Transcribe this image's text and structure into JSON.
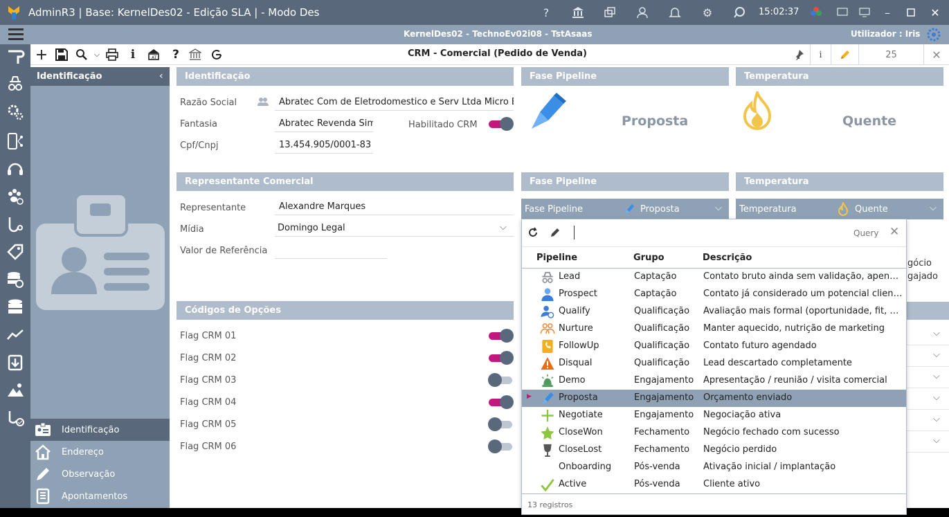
{
  "window": {
    "title": "AdminR3 | Base: KernelDes02 - Edição SLA | - Modo Des",
    "clock": "15:02:37"
  },
  "statusbar": {
    "center": "KernelDes02 - TechnoEv02i08 - TstAsaas",
    "user": "Utilizador : Iris"
  },
  "toolbar": {
    "form_title": "CRM - Comercial (Pedido de Venda)",
    "info": "i",
    "record": "25"
  },
  "sidebar": {
    "header": "Identificação",
    "nav": [
      {
        "label": "Identificação",
        "icon": "id-card-icon"
      },
      {
        "label": "Endereço",
        "icon": "house-icon"
      },
      {
        "label": "Observação",
        "icon": "pencil-icon"
      },
      {
        "label": "Apontamentos",
        "icon": "notebook-icon"
      }
    ]
  },
  "identificacao": {
    "header": "Identificação",
    "razao_label": "Razão Social",
    "razao_value": "Abratec Com de Eletrodomestico e Serv Ltda Micro Em",
    "fantasia_label": "Fantasia",
    "fantasia_value": "Abratec Revenda Sim",
    "habilitado_label": "Habilitado CRM",
    "habilitado_on": true,
    "cpf_label": "Cpf/Cnpj",
    "cpf_value": "13.454.905/0001-83"
  },
  "fase_top": {
    "header": "Fase Pipeline",
    "value": "Proposta"
  },
  "temp_top": {
    "header": "Temperatura",
    "value": "Quente"
  },
  "representante": {
    "header": "Representante Comercial",
    "rep_label": "Representante",
    "rep_value": "Alexandre Marques",
    "midia_label": "Mídia",
    "midia_value": "Domingo Legal",
    "valor_label": "Valor de Referência",
    "valor_value": ""
  },
  "fase_mid": {
    "header": "Fase Pipeline",
    "label": "Fase Pipeline",
    "value": "Proposta"
  },
  "temp_mid": {
    "header": "Temperatura",
    "label": "Temperatura",
    "value": "Quente"
  },
  "codigos": {
    "header": "Códigos de Opções",
    "flags": [
      {
        "label": "Flag CRM 01",
        "on": true
      },
      {
        "label": "Flag CRM 02",
        "on": true
      },
      {
        "label": "Flag CRM 03",
        "on": false
      },
      {
        "label": "Flag CRM 04",
        "on": true
      },
      {
        "label": "Flag CRM 05",
        "on": false
      },
      {
        "label": "Flag CRM 06",
        "on": false
      }
    ]
  },
  "behind_text": {
    "line1": "gócio",
    "line2": "gajado"
  },
  "dropdown": {
    "search_value": "",
    "query_label": "Query",
    "columns": [
      "Pipeline",
      "Grupo",
      "Descrição"
    ],
    "rows": [
      {
        "pipeline": "Lead",
        "grupo": "Captação",
        "descricao": "Contato bruto ainda sem validação, apenas...",
        "icon": "spy-icon"
      },
      {
        "pipeline": "Prospect",
        "grupo": "Captação",
        "descricao": "Contato já considerado um potencial cliente...",
        "icon": "person-icon"
      },
      {
        "pipeline": "Qualify",
        "grupo": "Qualificação",
        "descricao": "Avaliação mais formal (oportunidade, fit, nec...",
        "icon": "person-filter-icon"
      },
      {
        "pipeline": "Nurture",
        "grupo": "Qualificação",
        "descricao": "Manter aquecido, nutrição de marketing",
        "icon": "people-icon"
      },
      {
        "pipeline": "FollowUp",
        "grupo": "Qualificação",
        "descricao": "Contato futuro agendado",
        "icon": "phone-book-icon"
      },
      {
        "pipeline": "Disqual",
        "grupo": "Qualificação",
        "descricao": "Lead descartado completamente",
        "icon": "warning-icon"
      },
      {
        "pipeline": "Demo",
        "grupo": "Engajamento",
        "descricao": "Apresentação / reunião / visita comercial",
        "icon": "siren-icon"
      },
      {
        "pipeline": "Proposta",
        "grupo": "Engajamento",
        "descricao": "Orçamento enviado",
        "icon": "pen-icon"
      },
      {
        "pipeline": "Negotiate",
        "grupo": "Engajamento",
        "descricao": "Negociação ativa",
        "icon": "plus-icon"
      },
      {
        "pipeline": "CloseWon",
        "grupo": "Fechamento",
        "descricao": "Negócio fechado com sucesso",
        "icon": "star-icon"
      },
      {
        "pipeline": "CloseLost",
        "grupo": "Fechamento",
        "descricao": "Negócio perdido",
        "icon": "broken-glass-icon"
      },
      {
        "pipeline": "Onboarding",
        "grupo": "Pós-venda",
        "descricao": "Ativação inicial / implantação",
        "icon": ""
      },
      {
        "pipeline": "Active",
        "grupo": "Pós-venda",
        "descricao": "Cliente ativo",
        "icon": "check-icon"
      }
    ],
    "selected_index": 7,
    "footer": "13 registros"
  },
  "colors": {
    "titlebar": "#59697b",
    "header_panel": "#aebccb",
    "accent_toggle": "#c2187c",
    "selected_row": "#8fa1b5"
  }
}
